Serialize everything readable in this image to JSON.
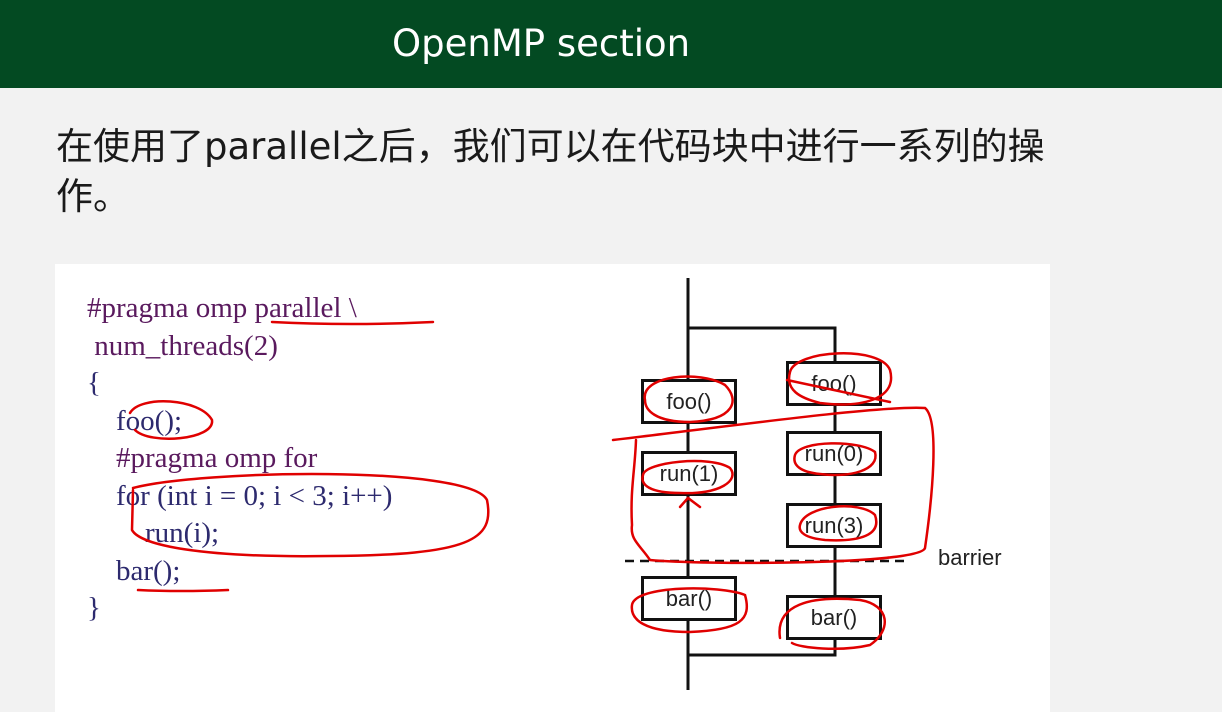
{
  "header": {
    "title": "OpenMP section"
  },
  "paragraph": "在使用了parallel之后，我们可以在代码块中进行一系列的操作。",
  "code": {
    "lines": [
      "#pragma omp parallel \\",
      " num_threads(2)",
      "{",
      "    foo();",
      "    #pragma omp for",
      "    for (int i = 0; i < 3; i++)",
      "        run(i);",
      "    bar();",
      "}"
    ]
  },
  "diagram": {
    "thread0": [
      "foo()",
      "run(1)",
      "bar()"
    ],
    "thread1": [
      "foo()",
      "run(0)",
      "run(3)",
      "bar()"
    ],
    "barrier_label": "barrier"
  },
  "colors": {
    "header": "#034a22",
    "annotation": "#e00000"
  }
}
